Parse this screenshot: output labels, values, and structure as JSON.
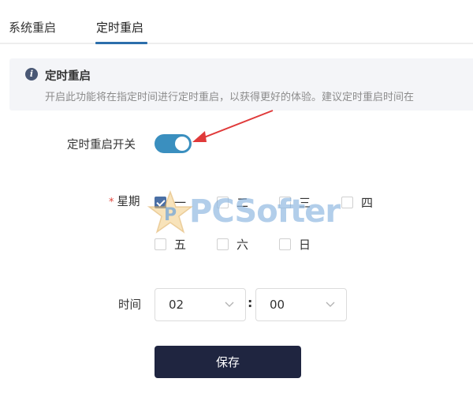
{
  "tabs": [
    {
      "label": "系统重启",
      "active": false
    },
    {
      "label": "定时重启",
      "active": true
    }
  ],
  "alert": {
    "icon": "info-icon",
    "title": "定时重启",
    "description": "开启此功能将在指定时间进行定时重启，以获得更好的体验。建议定时重启时间在"
  },
  "form": {
    "switch_label": "定时重启开关",
    "switch_on": true,
    "week_label": "星期",
    "required_mark": "*",
    "days": [
      {
        "label": "一",
        "checked": true
      },
      {
        "label": "二",
        "checked": false
      },
      {
        "label": "三",
        "checked": false
      },
      {
        "label": "四",
        "checked": false
      },
      {
        "label": "五",
        "checked": false
      },
      {
        "label": "六",
        "checked": false
      },
      {
        "label": "日",
        "checked": false
      }
    ],
    "time_label": "时间",
    "hour": "02",
    "separator": ":",
    "minute": "00",
    "save_label": "保存"
  },
  "watermark": {
    "text": "PCSofter"
  },
  "colors": {
    "accent": "#2c6eab",
    "switch_on": "#3a8fbf",
    "save_button": "#1f2540",
    "required": "#e0453c",
    "annotation_arrow": "#e03a3a"
  }
}
